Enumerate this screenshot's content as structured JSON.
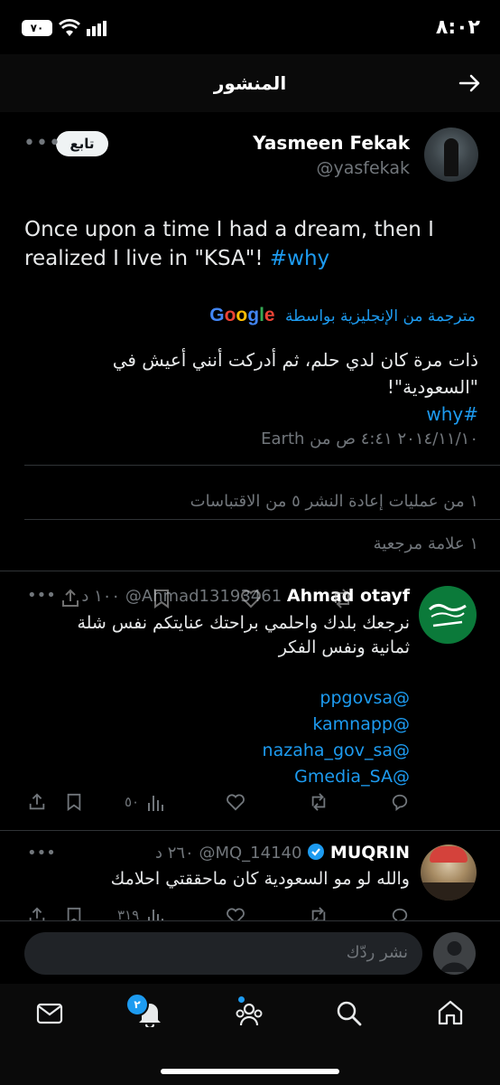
{
  "status_bar": {
    "time": "٨:٠٢",
    "battery": "٧٠"
  },
  "header": {
    "title": "المنشور"
  },
  "post": {
    "author_name": "Yasmeen Fekak",
    "handle": "@yasfekak",
    "follow_label": "تابع",
    "text_line1": "Once upon a time I had a dream, then I",
    "text_line2_plain": "realized I live in \"KSA\"! ",
    "hashtag": "#why",
    "translated_by": "مترجمة من الإنجليزية بواسطة",
    "google": "Google",
    "translation_line1": "ذات مرة كان لدي حلم، ثم أدركت أنني أعيش في \"السعودية\"!",
    "translation_hashtag": "#why",
    "meta": "٢٠١٤/١١/١٠ ٤:٤١ ص من Earth",
    "stats_line1": "١ من عمليات إعادة النشر ٥ من الاقتباسات",
    "stats_line2": "١ علامة مرجعية"
  },
  "replies": [
    {
      "name": "Ahmad otayf",
      "handle": "@Ahmad13193461",
      "time": "١٠٠ د",
      "text_line1": "نرجعك بلدك واحلمي براحتك عنايتكم نفس شلة",
      "text_line2": "ثمانية ونفس الفكر",
      "mentions": [
        "@ppgovsa",
        "@kamnapp",
        "@nazaha_gov_sa",
        "@Gmedia_SA"
      ],
      "views": "٥٠"
    },
    {
      "name": "MUQRIN",
      "handle": "@MQ_14140",
      "time": "٢٦٠ د",
      "text_line1": "والله لو مو السعودية كان ماحققتي احلامك",
      "views": "٣١٩"
    }
  ],
  "composer": {
    "placeholder": "نشر ردّك"
  },
  "bottom_nav": {
    "notifications_badge": "٢"
  },
  "colors": {
    "accent": "#1d9bf0",
    "background": "#000000",
    "muted": "#71767b"
  }
}
